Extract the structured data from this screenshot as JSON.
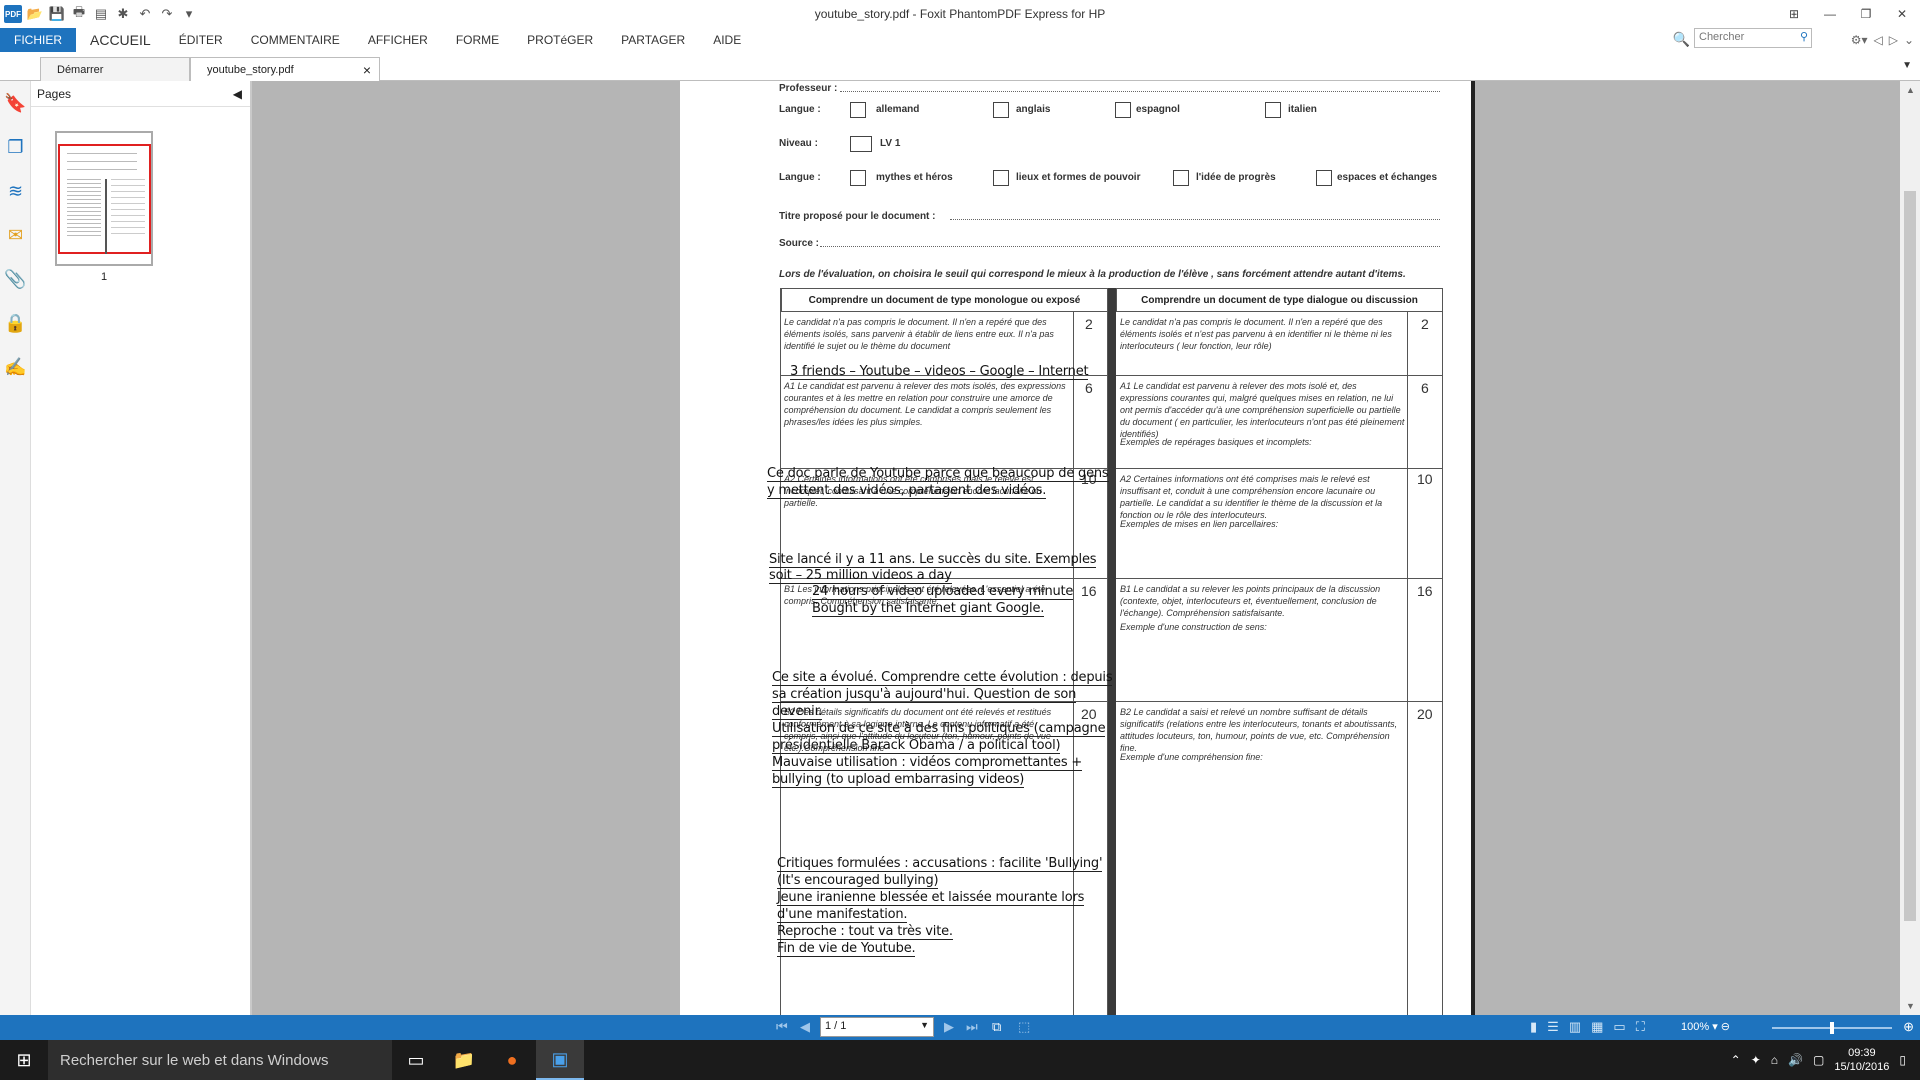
{
  "app": {
    "title": "youtube_story.pdf - Foxit PhantomPDF Express for HP"
  },
  "menu": {
    "items": [
      "FICHIER",
      "ACCUEIL",
      "ÉDITER",
      "COMMENTAIRE",
      "AFFICHER",
      "FORME",
      "PROTéGER",
      "PARTAGER",
      "AIDE"
    ]
  },
  "search": {
    "placeholder": "Chercher"
  },
  "tabs": [
    {
      "label": "Démarrer"
    },
    {
      "label": "youtube_story.pdf"
    }
  ],
  "pages_panel": {
    "title": "Pages",
    "thumb_number": "1"
  },
  "navbar": {
    "page_indicator": "1 / 1",
    "zoom": "100%"
  },
  "taskbar": {
    "search_placeholder": "Rechercher sur le web et dans Windows",
    "time": "09:39",
    "date": "15/10/2016"
  },
  "document": {
    "professeur_label": "Professeur :",
    "langue_label": "Langue :",
    "langues": [
      "allemand",
      "anglais",
      "espagnol",
      "italien"
    ],
    "niveau_label": "Niveau :",
    "niveau": "LV 1",
    "notions_label": "Langue :",
    "notions": [
      "mythes et héros",
      "lieux et formes de pouvoir",
      "l'idée de progrès",
      "espaces et échanges"
    ],
    "titre_label": "Titre proposé pour le document :",
    "source_label": "Source :",
    "instruction": "Lors de l'évaluation, on  choisira le seuil qui correspond le mieux à la production de l'élève , sans forcément attendre autant d'items.",
    "col_a_header": "Comprendre un document de type monologue ou exposé",
    "col_b_header": "Comprendre un document de type dialogue ou discussion",
    "rows_a": [
      {
        "text": "Le candidat n'a pas compris le document. Il n'en a repéré que des éléments isolés, sans parvenir à établir de liens entre eux. Il n'a pas identifié le sujet ou le thème du document",
        "score": "2"
      },
      {
        "text": "A1  Le candidat est parvenu à relever des mots isolés, des expressions courantes et à les mettre en relation pour construire une amorce de compréhension du document. Le candidat a compris seulement les phrases/les idées les plus simples.",
        "score": "6"
      },
      {
        "text": "A2  Certaines informations ont été comprises mais le relevé est incomplet, conduisant à une compréhension encore lacunaire ou partielle.",
        "score": "10"
      },
      {
        "text": "B1  Les informations principales ont été relevées. L'essentiel a été compris. Compréhension satisfaisante.",
        "score": "16"
      },
      {
        "text": "B2 Des détails significatifs du document ont été relevés et restitués conformément à sa logique interne. Le contenu informatif a été compris, ainsi que l'attitude du locuteur (ton, humour, points de vue etc.).Compréhension fine",
        "score": "20"
      }
    ],
    "rows_b": [
      {
        "text": "Le candidat n'a pas compris le document. Il n'en a repéré que des éléments isolés et n'est pas parvenu à en identifier ni le thème ni les interlocuteurs ( leur fonction, leur rôle)",
        "score": "2"
      },
      {
        "text": "A1 Le candidat est parvenu à relever des mots isolé et, des expressions courantes qui, malgré quelques mises en relation, ne lui ont permis d'accéder qu'à une compréhension superficielle ou partielle du document ( en particulier, les interlocuteurs n'ont pas été pleinement identifiés)",
        "example": "Exemples  de repérages basiques et incomplets:",
        "score": "6"
      },
      {
        "text": "A2 Certaines informations ont été comprises mais le relevé est insuffisant et, conduit à une compréhension encore lacunaire ou partielle. Le candidat a su identifier le thème de la discussion et la fonction ou le rôle des interlocuteurs.",
        "example": "Exemples  de mises en lien parcellaires:",
        "score": "10"
      },
      {
        "text": "B1  Le candidat a su relever les points principaux de la discussion (contexte, objet, interlocuteurs et, éventuellement, conclusion de l'échange). Compréhension satisfaisante.",
        "example": "Exemple  d'une construction de sens:",
        "score": "16"
      },
      {
        "text": "B2 Le candidat a saisi et relevé un nombre suffisant de détails significatifs (relations entre les interlocuteurs, tonants et aboutissants, attitudes locuteurs, ton, humour, points de vue, etc. Compréhension fine.",
        "example": "Exemple  d'une compréhension fine:",
        "score": "20"
      }
    ],
    "handwriting": [
      "3 friends – Youtube – videos – Google – Internet",
      "Ce doc parle de Youtube parce que beaucoup de gens",
      "y mettent des vidéos, partagent des vidéos.",
      "Site lancé il y a 11 ans. Le succès du site. Exemples",
      "soit – 25 million videos a day",
      "24 hours of video uploaded every minute",
      "Bought by the Internet giant Google.",
      "Ce site a évolué. Comprendre cette évolution : depuis",
      "sa création jusqu'à aujourd'hui. Question de son",
      "devenir.",
      "Utilisation de ce site à des fins politiques (campagne",
      "présidentielle Barack Obama / a political tool)",
      "Mauvaise utilisation : vidéos compromettantes +",
      "bullying (to upload embarrasing videos)",
      "Critiques formulées : accusations : facilite 'Bullying'",
      "(It's encouraged bullying)",
      "Jeune iranienne blessée  et laissée mourante lors",
      "d'une manifestation.",
      "Reproche : tout va très vite.",
      "Fin de vie de Youtube."
    ]
  }
}
